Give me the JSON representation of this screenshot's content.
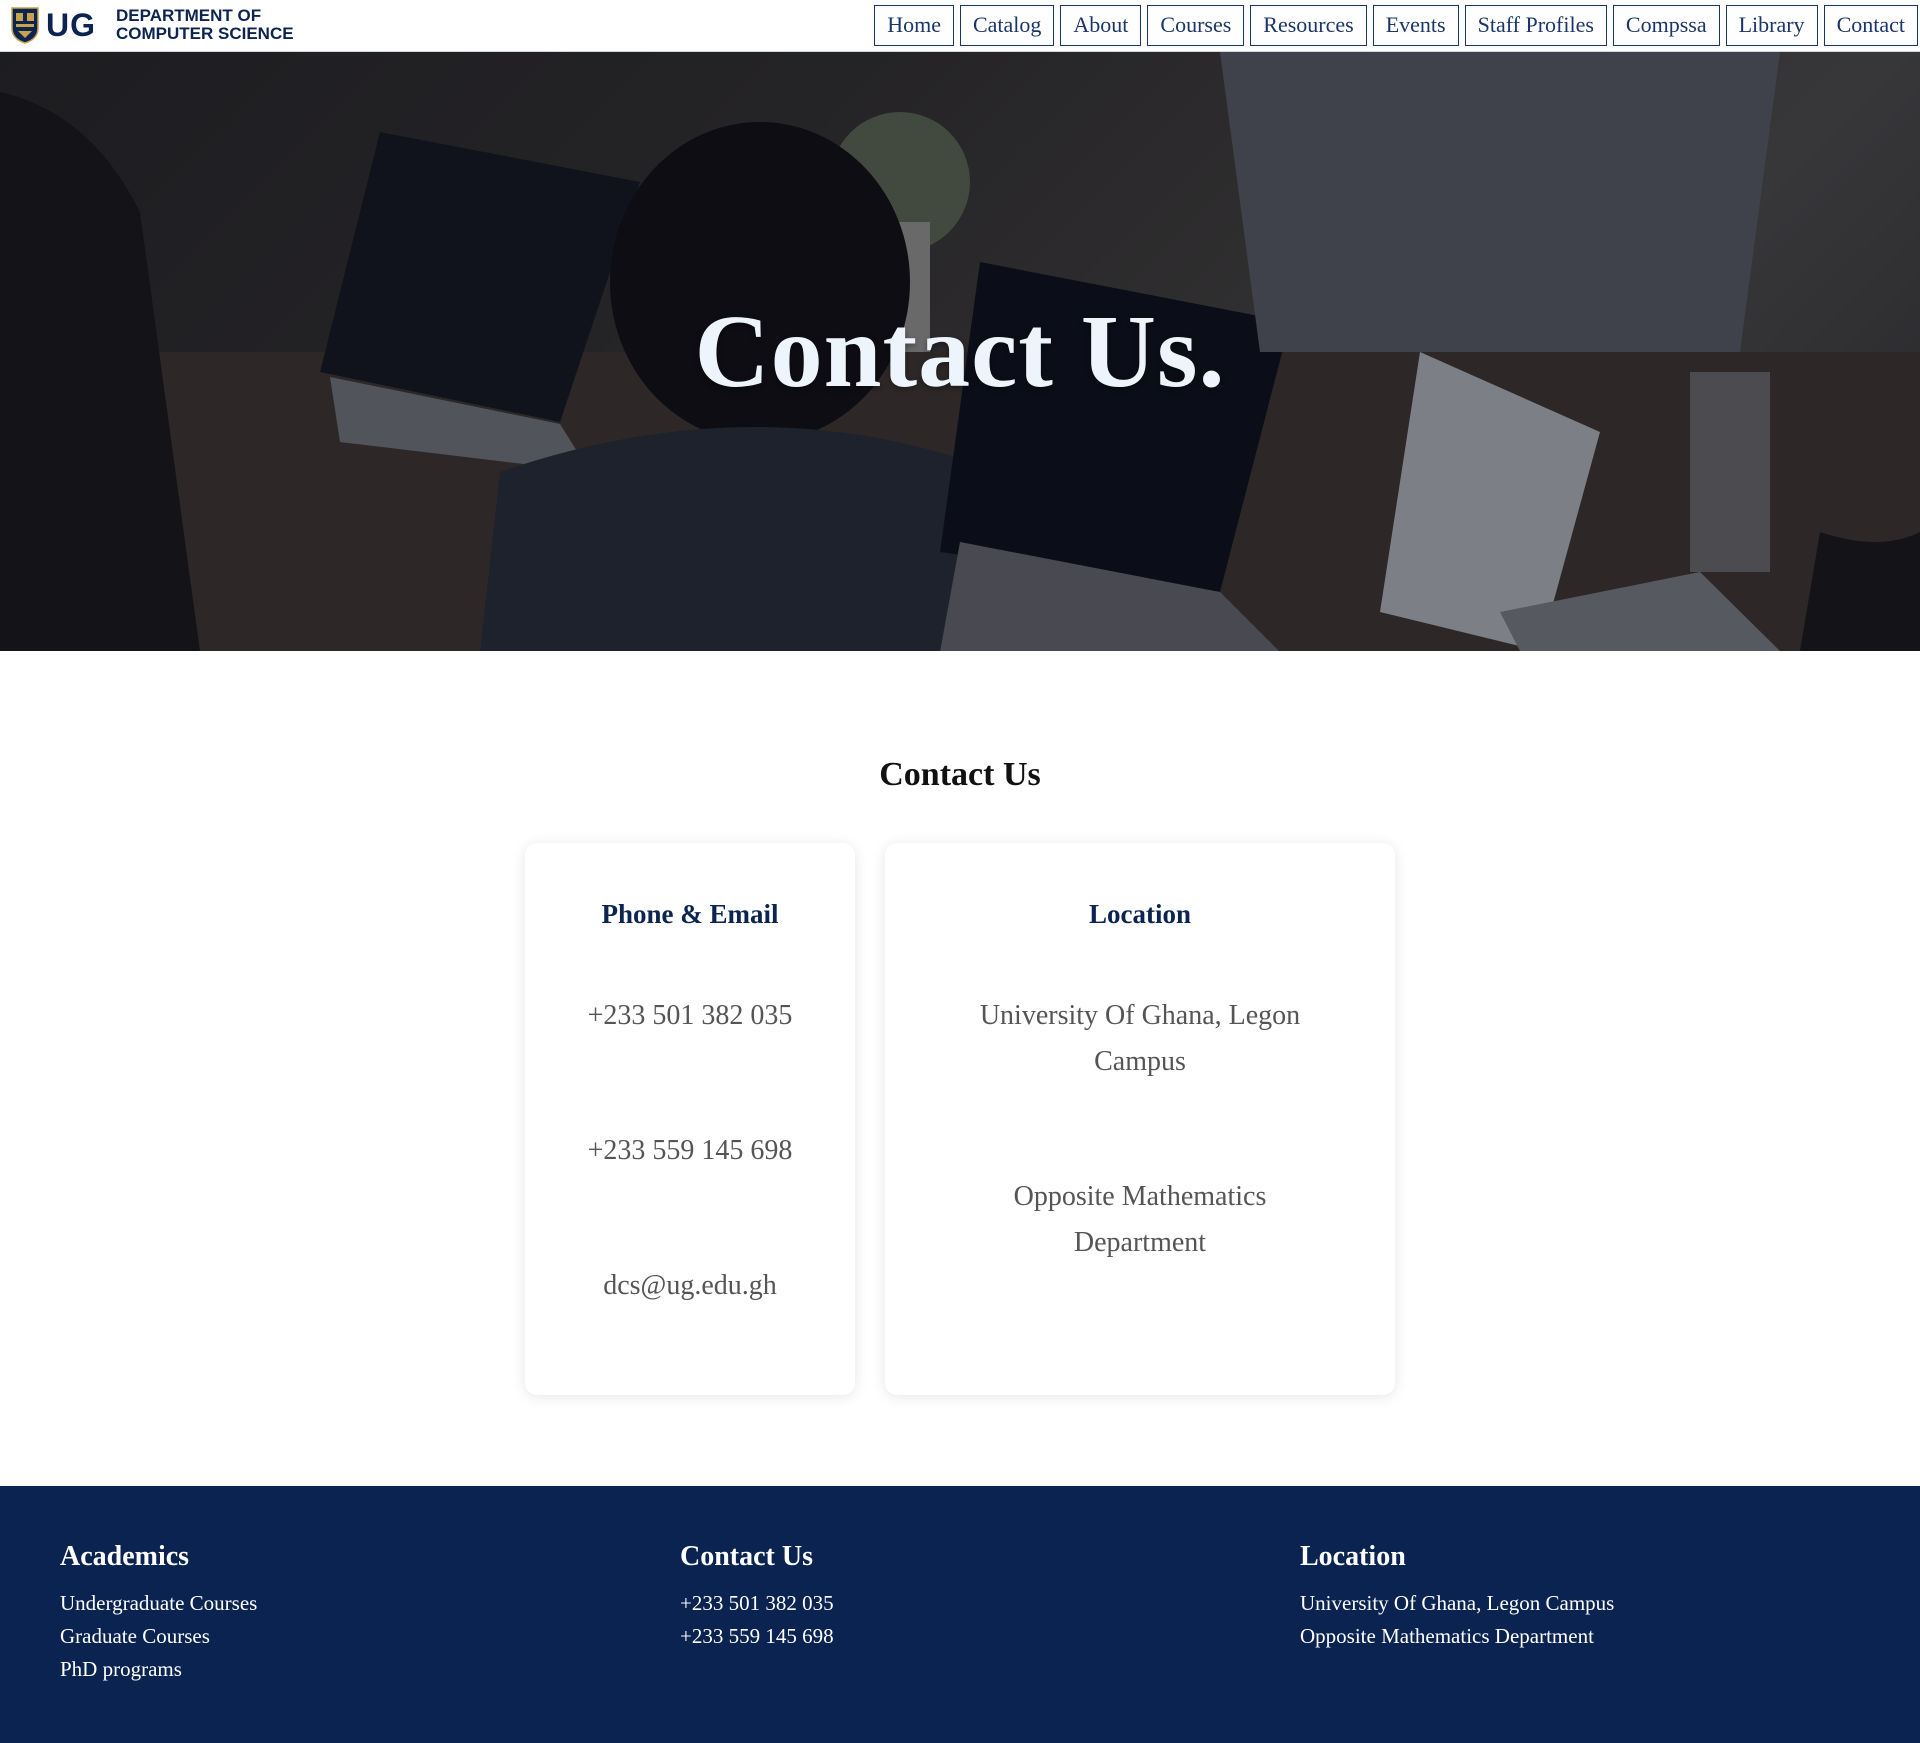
{
  "header": {
    "logo_text": "UG",
    "dept_line1": "DEPARTMENT OF",
    "dept_line2": "COMPUTER SCIENCE",
    "nav": [
      {
        "label": "Home"
      },
      {
        "label": "Catalog"
      },
      {
        "label": "About"
      },
      {
        "label": "Courses"
      },
      {
        "label": "Resources"
      },
      {
        "label": "Events"
      },
      {
        "label": "Staff Profiles"
      },
      {
        "label": "Compssa"
      },
      {
        "label": "Library"
      },
      {
        "label": "Contact"
      }
    ]
  },
  "hero": {
    "title": "Contact Us."
  },
  "contact": {
    "title": "Contact Us",
    "phone_card": {
      "heading": "Phone & Email",
      "phone1": "+233 501 382 035",
      "phone2": "+233 559 145 698",
      "email": "dcs@ug.edu.gh"
    },
    "location_card": {
      "heading": "Location",
      "line1": "University Of Ghana, Legon Campus",
      "line2": "Opposite Mathematics Department"
    }
  },
  "footer": {
    "academics": {
      "heading": "Academics",
      "links": [
        "Undergraduate Courses",
        "Graduate Courses",
        "PhD programs"
      ]
    },
    "contact": {
      "heading": "Contact Us",
      "phones": [
        "+233 501 382 035",
        "+233 559 145 698"
      ]
    },
    "location": {
      "heading": "Location",
      "lines": [
        "University Of Ghana, Legon Campus",
        "Opposite Mathematics Department"
      ]
    }
  },
  "colors": {
    "navy": "#0b2350",
    "nav_border": "#1a3568"
  }
}
